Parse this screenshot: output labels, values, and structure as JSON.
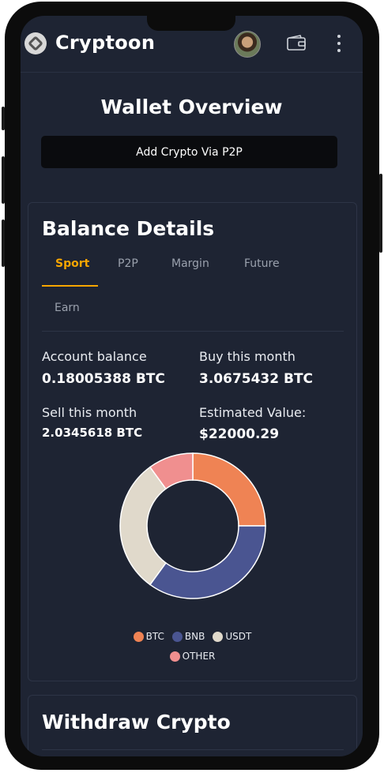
{
  "app": {
    "brand": "Cryptoon",
    "logo_icon": "cryptoon-logo-icon"
  },
  "header": {
    "avatar": "user-avatar",
    "wallet_icon": "wallet-icon",
    "more_icon": "more-vertical-icon"
  },
  "overview": {
    "title": "Wallet Overview",
    "p2p_button": "Add Crypto Via P2P"
  },
  "balance": {
    "title": "Balance Details",
    "tabs": [
      "Sport",
      "P2P",
      "Margin",
      "Future",
      "Earn"
    ],
    "active_tab": "Sport",
    "stats": {
      "account_balance_label": "Account balance",
      "account_balance_value": "0.18005388 BTC",
      "buy_label": "Buy this month",
      "buy_value": "3.0675432 BTC",
      "sell_label": "Sell this month",
      "sell_value": "2.0345618 BTC",
      "estimated_label": "Estimated Value:",
      "estimated_value": "$22000.29"
    }
  },
  "chart_data": {
    "type": "pie",
    "donut": true,
    "series": [
      {
        "name": "BTC",
        "value": 25,
        "color": "#ef8354"
      },
      {
        "name": "BNB",
        "value": 35,
        "color": "#4a5591"
      },
      {
        "name": "USDT",
        "value": 30,
        "color": "#e0d9cb"
      },
      {
        "name": "OTHER",
        "value": 10,
        "color": "#f08f8f"
      }
    ],
    "legend": "bottom"
  },
  "withdraw": {
    "title": "Withdraw Crypto"
  },
  "colors": {
    "accent": "#f7a600",
    "background": "#1e2433",
    "button": "#0a0b0e"
  }
}
